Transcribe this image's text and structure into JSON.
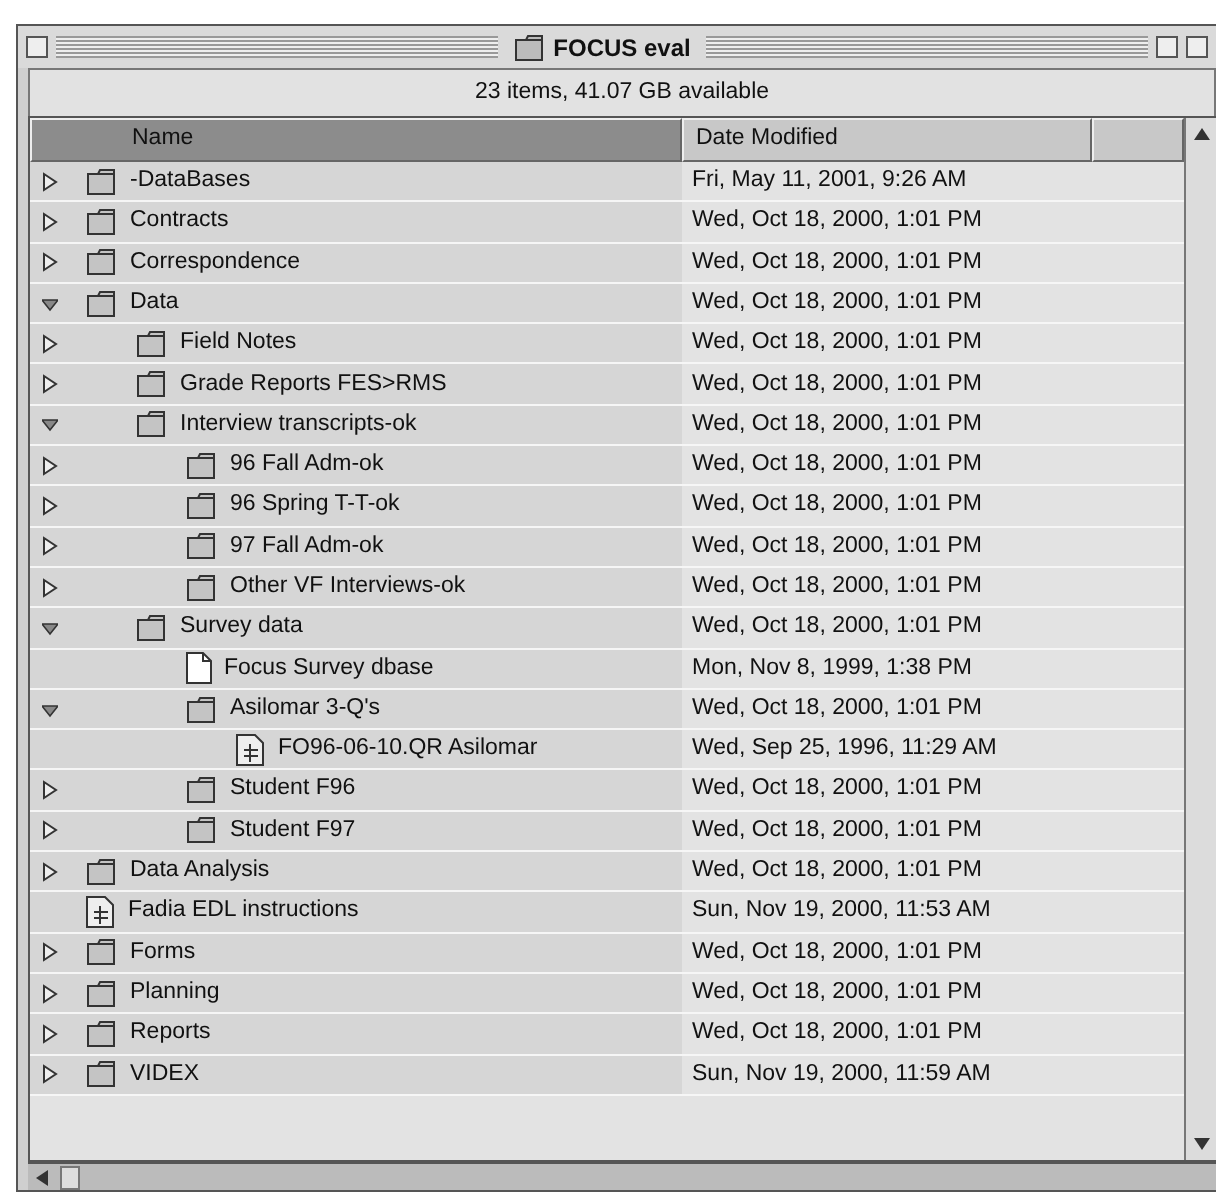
{
  "window": {
    "title": "FOCUS eval"
  },
  "info_bar": "23 items, 41.07 GB available",
  "columns": [
    {
      "label": "Name",
      "selected": true
    },
    {
      "label": "Date Modified",
      "selected": false
    }
  ],
  "items": [
    {
      "name": "-DataBases",
      "date": "Fri, May 11, 2001, 9:26 AM",
      "kind": "folder",
      "expanded": false
    },
    {
      "name": "Contracts",
      "date": "Wed, Oct 18, 2000, 1:01 PM",
      "kind": "folder",
      "expanded": false
    },
    {
      "name": "Correspondence",
      "date": "Wed, Oct 18, 2000, 1:01 PM",
      "kind": "folder",
      "expanded": false
    },
    {
      "name": "Data",
      "date": "Wed, Oct 18, 2000, 1:01 PM",
      "kind": "folder",
      "expanded": true,
      "children": [
        {
          "name": "Field Notes",
          "date": "Wed, Oct 18, 2000, 1:01 PM",
          "kind": "folder",
          "expanded": false
        },
        {
          "name": "Grade Reports FES>RMS",
          "date": "Wed, Oct 18, 2000, 1:01 PM",
          "kind": "folder",
          "expanded": false
        },
        {
          "name": "Interview transcripts-ok",
          "date": "Wed, Oct 18, 2000, 1:01 PM",
          "kind": "folder",
          "expanded": true,
          "children": [
            {
              "name": "96 Fall Adm-ok",
              "date": "Wed, Oct 18, 2000, 1:01 PM",
              "kind": "folder",
              "expanded": false
            },
            {
              "name": "96 Spring T-T-ok",
              "date": "Wed, Oct 18, 2000, 1:01 PM",
              "kind": "folder",
              "expanded": false
            },
            {
              "name": "97 Fall Adm-ok",
              "date": "Wed, Oct 18, 2000, 1:01 PM",
              "kind": "folder",
              "expanded": false
            },
            {
              "name": "Other VF Interviews-ok",
              "date": "Wed, Oct 18, 2000, 1:01 PM",
              "kind": "folder",
              "expanded": false
            }
          ]
        },
        {
          "name": "Survey data",
          "date": "Wed, Oct 18, 2000, 1:01 PM",
          "kind": "folder",
          "expanded": true,
          "children": [
            {
              "name": "Focus Survey dbase",
              "date": "Mon, Nov 8, 1999, 1:38 PM",
              "kind": "document"
            },
            {
              "name": "Asilomar 3-Q's",
              "date": "Wed, Oct 18, 2000, 1:01 PM",
              "kind": "folder",
              "expanded": true,
              "children": [
                {
                  "name": "FO96-06-10.QR Asilomar",
                  "date": "Wed, Sep 25, 1996, 11:29 AM",
                  "kind": "app-document"
                }
              ]
            },
            {
              "name": "Student F96",
              "date": "Wed, Oct 18, 2000, 1:01 PM",
              "kind": "folder",
              "expanded": false
            },
            {
              "name": "Student F97",
              "date": "Wed, Oct 18, 2000, 1:01 PM",
              "kind": "folder",
              "expanded": false
            }
          ]
        }
      ]
    },
    {
      "name": "Data Analysis",
      "date": "Wed, Oct 18, 2000, 1:01 PM",
      "kind": "folder",
      "expanded": false
    },
    {
      "name": "Fadia EDL instructions",
      "date": "Sun, Nov 19, 2000, 11:53 AM",
      "kind": "app-document"
    },
    {
      "name": "Forms",
      "date": "Wed, Oct 18, 2000, 1:01 PM",
      "kind": "folder",
      "expanded": false
    },
    {
      "name": "Planning",
      "date": "Wed, Oct 18, 2000, 1:01 PM",
      "kind": "folder",
      "expanded": false
    },
    {
      "name": "Reports",
      "date": "Wed, Oct 18, 2000, 1:01 PM",
      "kind": "folder",
      "expanded": false
    },
    {
      "name": "VIDEX",
      "date": "Sun, Nov 19, 2000, 11:59 AM",
      "kind": "folder",
      "expanded": false
    }
  ]
}
